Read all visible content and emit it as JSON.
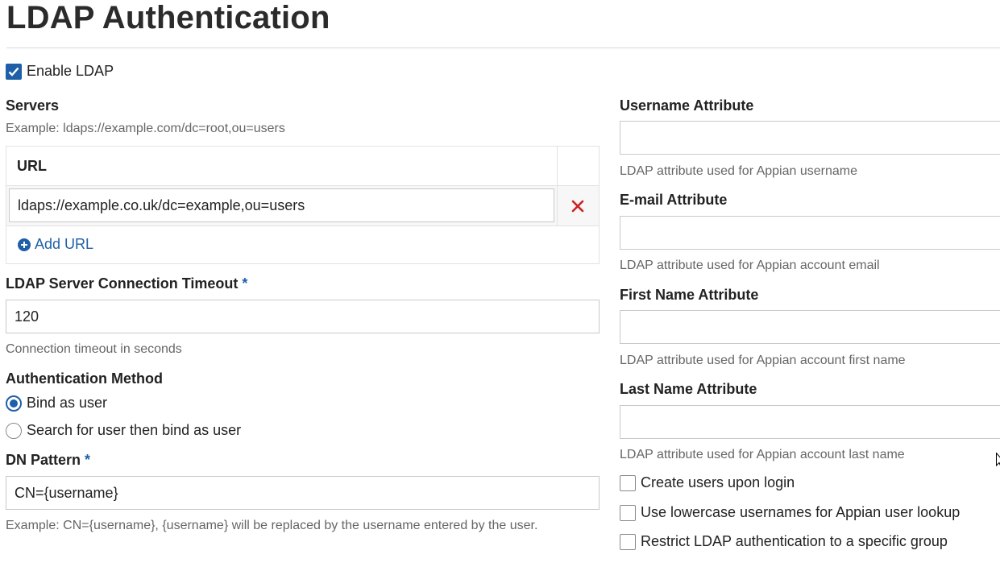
{
  "page": {
    "title": "LDAP Authentication"
  },
  "enable_ldap": {
    "label": "Enable LDAP",
    "checked": true
  },
  "servers": {
    "label": "Servers",
    "hint": "Example: ldaps://example.com/dc=root,ou=users",
    "column_header": "URL",
    "rows": [
      {
        "url": "ldaps://example.co.uk/dc=example,ou=users"
      }
    ],
    "add_label": "Add URL"
  },
  "timeout": {
    "label": "LDAP Server Connection Timeout",
    "required_mark": "*",
    "value": "120",
    "hint": "Connection timeout in seconds"
  },
  "auth_method": {
    "label": "Authentication Method",
    "options": [
      {
        "label": "Bind as user",
        "selected": true
      },
      {
        "label": "Search for user then bind as user",
        "selected": false
      }
    ]
  },
  "dn_pattern": {
    "label": "DN Pattern",
    "required_mark": "*",
    "value": "CN={username}",
    "hint": "Example: CN={username}, {username} will be replaced by the username entered by the user."
  },
  "username_attr": {
    "label": "Username Attribute",
    "value": "",
    "hint": "LDAP attribute used for Appian username"
  },
  "email_attr": {
    "label": "E-mail Attribute",
    "value": "",
    "hint": "LDAP attribute used for Appian account email"
  },
  "first_name_attr": {
    "label": "First Name Attribute",
    "value": "",
    "hint": "LDAP attribute used for Appian account first name"
  },
  "last_name_attr": {
    "label": "Last Name Attribute",
    "value": "",
    "hint": "LDAP attribute used for Appian account last name"
  },
  "options": {
    "create_users": {
      "label": "Create users upon login",
      "checked": false
    },
    "lowercase": {
      "label": "Use lowercase usernames for Appian user lookup",
      "checked": false
    },
    "restrict_group": {
      "label": "Restrict LDAP authentication to a specific group",
      "checked": false
    }
  },
  "colors": {
    "accent": "#1f5fa8",
    "delete": "#cc2222",
    "hint_text": "#666666"
  }
}
